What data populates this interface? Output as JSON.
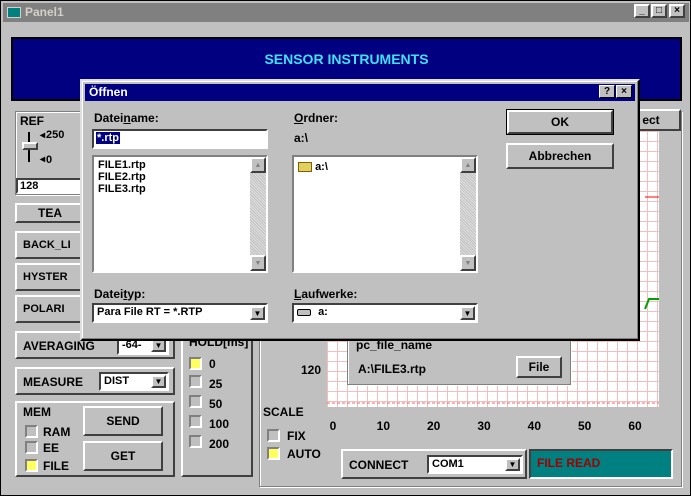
{
  "window": {
    "title": "Panel1",
    "min": "_",
    "max": "□",
    "close": "×"
  },
  "header": {
    "title": "SENSOR INSTRUMENTS"
  },
  "ref": {
    "label": "REF",
    "max": "250",
    "zero": "0",
    "value": "128",
    "teach_label": "TEA"
  },
  "left_buttons": [
    "BACK_LI",
    "HYSTER",
    "POLARI"
  ],
  "averaging": {
    "label": "AVERAGING",
    "value": "-64-"
  },
  "measure": {
    "label": "MEASURE",
    "value": "DIST"
  },
  "mem": {
    "label": "MEM",
    "options": [
      {
        "label": "RAM",
        "on": false
      },
      {
        "label": "EE",
        "on": false
      },
      {
        "label": "FILE",
        "on": true
      }
    ],
    "send_label": "SEND",
    "get_label": "GET"
  },
  "hold": {
    "label": "HOLD[ms]",
    "options": [
      {
        "label": "0",
        "on": true
      },
      {
        "label": "25",
        "on": false
      },
      {
        "label": "50",
        "on": false
      },
      {
        "label": "100",
        "on": false
      },
      {
        "label": "200",
        "on": false
      }
    ]
  },
  "file_group": {
    "label": "pc_file_name",
    "value": "A:\\FILE3.rtp",
    "button_label": "File"
  },
  "chart_data": {
    "type": "line",
    "y_tick": "120",
    "x_ticks": [
      "0",
      "10",
      "20",
      "30",
      "40",
      "50",
      "60"
    ],
    "xlim": [
      0,
      60
    ]
  },
  "scale": {
    "label": "SCALE",
    "options": [
      {
        "label": "FIX",
        "on": false
      },
      {
        "label": "AUTO",
        "on": true
      }
    ]
  },
  "connect": {
    "label": "CONNECT",
    "value": "COM1"
  },
  "status": {
    "text": "FILE READ",
    "color": "#a00000",
    "bg": "#008080"
  },
  "select_label": "ect",
  "dialog": {
    "title": "Öffnen",
    "help": "?",
    "close": "×",
    "filename_label": "Dateiname:",
    "filename_value": "*.rtp",
    "files": [
      "FILE1.rtp",
      "FILE2.rtp",
      "FILE3.rtp"
    ],
    "folder_label": "Ordner:",
    "folder_value": "a:\\",
    "folders": [
      "a:\\"
    ],
    "ok_label": "OK",
    "cancel_label": "Abbrechen",
    "filetype_label": "Dateityp:",
    "filetype_value": "Para File RT = *.RTP",
    "drives_label": "Laufwerke:",
    "drives_value": "a:"
  }
}
